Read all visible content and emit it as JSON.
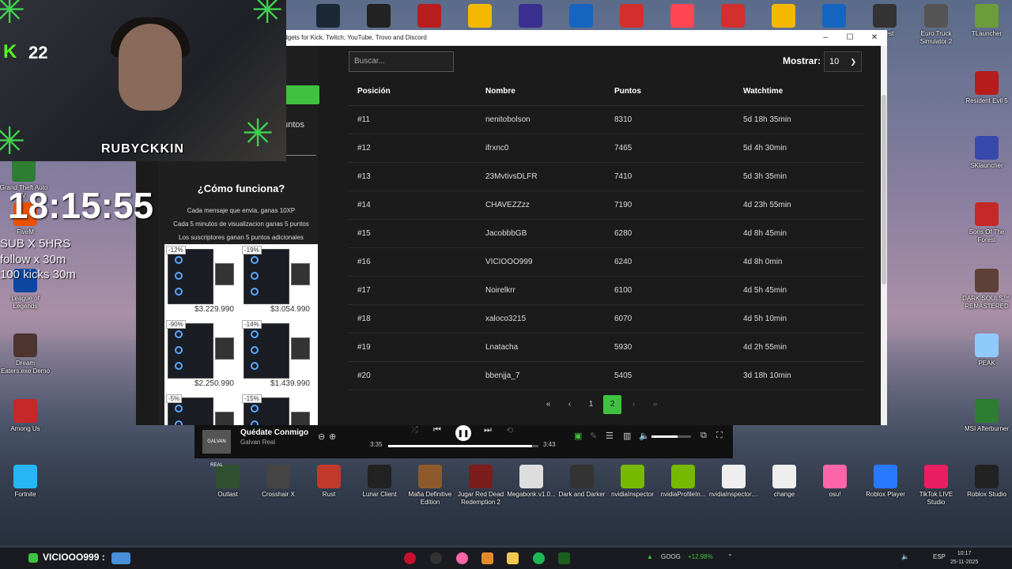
{
  "window": {
    "title": "Widgets for Kick, Twitch, YouTube, Trovo and Discord",
    "minimize": "–",
    "maximize": "☐",
    "close": "✕"
  },
  "sidebar": {
    "green_button": "k",
    "points_label": "puntos",
    "how_title": "¿Cómo funciona?",
    "how_lines": [
      "Cada mensaje que envia, ganas 10XP",
      "Cada 5 minutos de visualizacion ganas 5 puntos",
      "Los suscriptores ganan 5 puntos adicionales"
    ],
    "ad": {
      "items": [
        {
          "discount": "-12%",
          "price": "$3.229.990"
        },
        {
          "discount": "-19%",
          "price": "$3.054.990"
        },
        {
          "discount": "-90%",
          "price": "$2.250.990"
        },
        {
          "discount": "-14%",
          "price": "$1.439.990"
        },
        {
          "discount": "-5%",
          "price": ""
        },
        {
          "discount": "-15%",
          "price": ""
        }
      ]
    }
  },
  "controls": {
    "search_placeholder": "Buscar...",
    "show_label": "Mostrar:",
    "show_value": "10"
  },
  "table": {
    "headers": [
      "Posición",
      "Nombre",
      "Puntos",
      "Watchtime"
    ],
    "rows": [
      [
        "#11",
        "nenitobolson",
        "8310",
        "5d 18h 35min"
      ],
      [
        "#12",
        "ifrxnc0",
        "7465",
        "5d 4h 30min"
      ],
      [
        "#13",
        "23MvtivsDLFR",
        "7410",
        "5d 3h 35min"
      ],
      [
        "#14",
        "CHAVEZZzz",
        "7190",
        "4d 23h 55min"
      ],
      [
        "#15",
        "JacobbbGB",
        "6280",
        "4d 8h 45min"
      ],
      [
        "#16",
        "VICIOOO999",
        "6240",
        "4d 8h 0min"
      ],
      [
        "#17",
        "Noirelkrr",
        "6100",
        "4d 5h 45min"
      ],
      [
        "#18",
        "xaloco3215",
        "6070",
        "4d 5h 10min"
      ],
      [
        "#19",
        "Lnatacha",
        "5930",
        "4d 2h 55min"
      ],
      [
        "#20",
        "bbenjja_7",
        "5405",
        "3d 18h 10min"
      ]
    ]
  },
  "pagination": {
    "first": "«",
    "prev": "‹",
    "pages": [
      "1",
      "2"
    ],
    "current": "2",
    "next": "›",
    "last": "»"
  },
  "overlay": {
    "kick_badge": "K",
    "kick_count": "22",
    "streamer_name": "RUBYCKKIN",
    "clock": "18:15:55",
    "info_lines": [
      "SUB X 5HRS",
      "follow x 30m",
      "100 kicks 30m"
    ]
  },
  "media": {
    "album_label": "GALVAN REAL",
    "song": "Quédate Conmigo",
    "artist": "Galvan Real",
    "elapsed": "3:35",
    "total": "3:43",
    "progress": 0.96,
    "volume": 0.65
  },
  "desktop_icons": {
    "top": [
      "Steam",
      "Epic Games",
      "",
      "Rockstar",
      "",
      "Fortnite",
      "",
      "Valorant",
      "",
      "",
      "Logitech",
      "Forest",
      "Euro Truck Simulator 2",
      "TLauncher"
    ],
    "left": [
      "Grand Theft Auto V",
      "FiveM",
      "League of Legends",
      "Dream Eaters.exe Demo",
      "Among Us",
      "Fortnite"
    ],
    "right": [
      "Resident Evil 5",
      "SKlauncher",
      "Sons Of The Forest",
      "DARK SOULS™: REMASTERED",
      "PEAK",
      "MSI Afterburner"
    ],
    "bottom": [
      "Outlast",
      "Crosshair X",
      "Rust",
      "Lunar Client",
      "Mafia Definitive Edition",
      "Jugar Red Dead Redemption 2",
      "Megabonk.v1.0...",
      "Dark and Darker",
      "nvidiaInspector",
      "nvidiaProfileIn...",
      "nvidiaInspector....",
      "change",
      "osu!",
      "Roblox Player",
      "TikTok LIVE Studio",
      "Roblox Studio"
    ]
  },
  "taskbar": {
    "user": "VICIOOO999 :",
    "stock": "GOOG",
    "stock_change": "+12.98%",
    "lang": "ESP",
    "time": "10:17",
    "date": "25-11-2025"
  }
}
